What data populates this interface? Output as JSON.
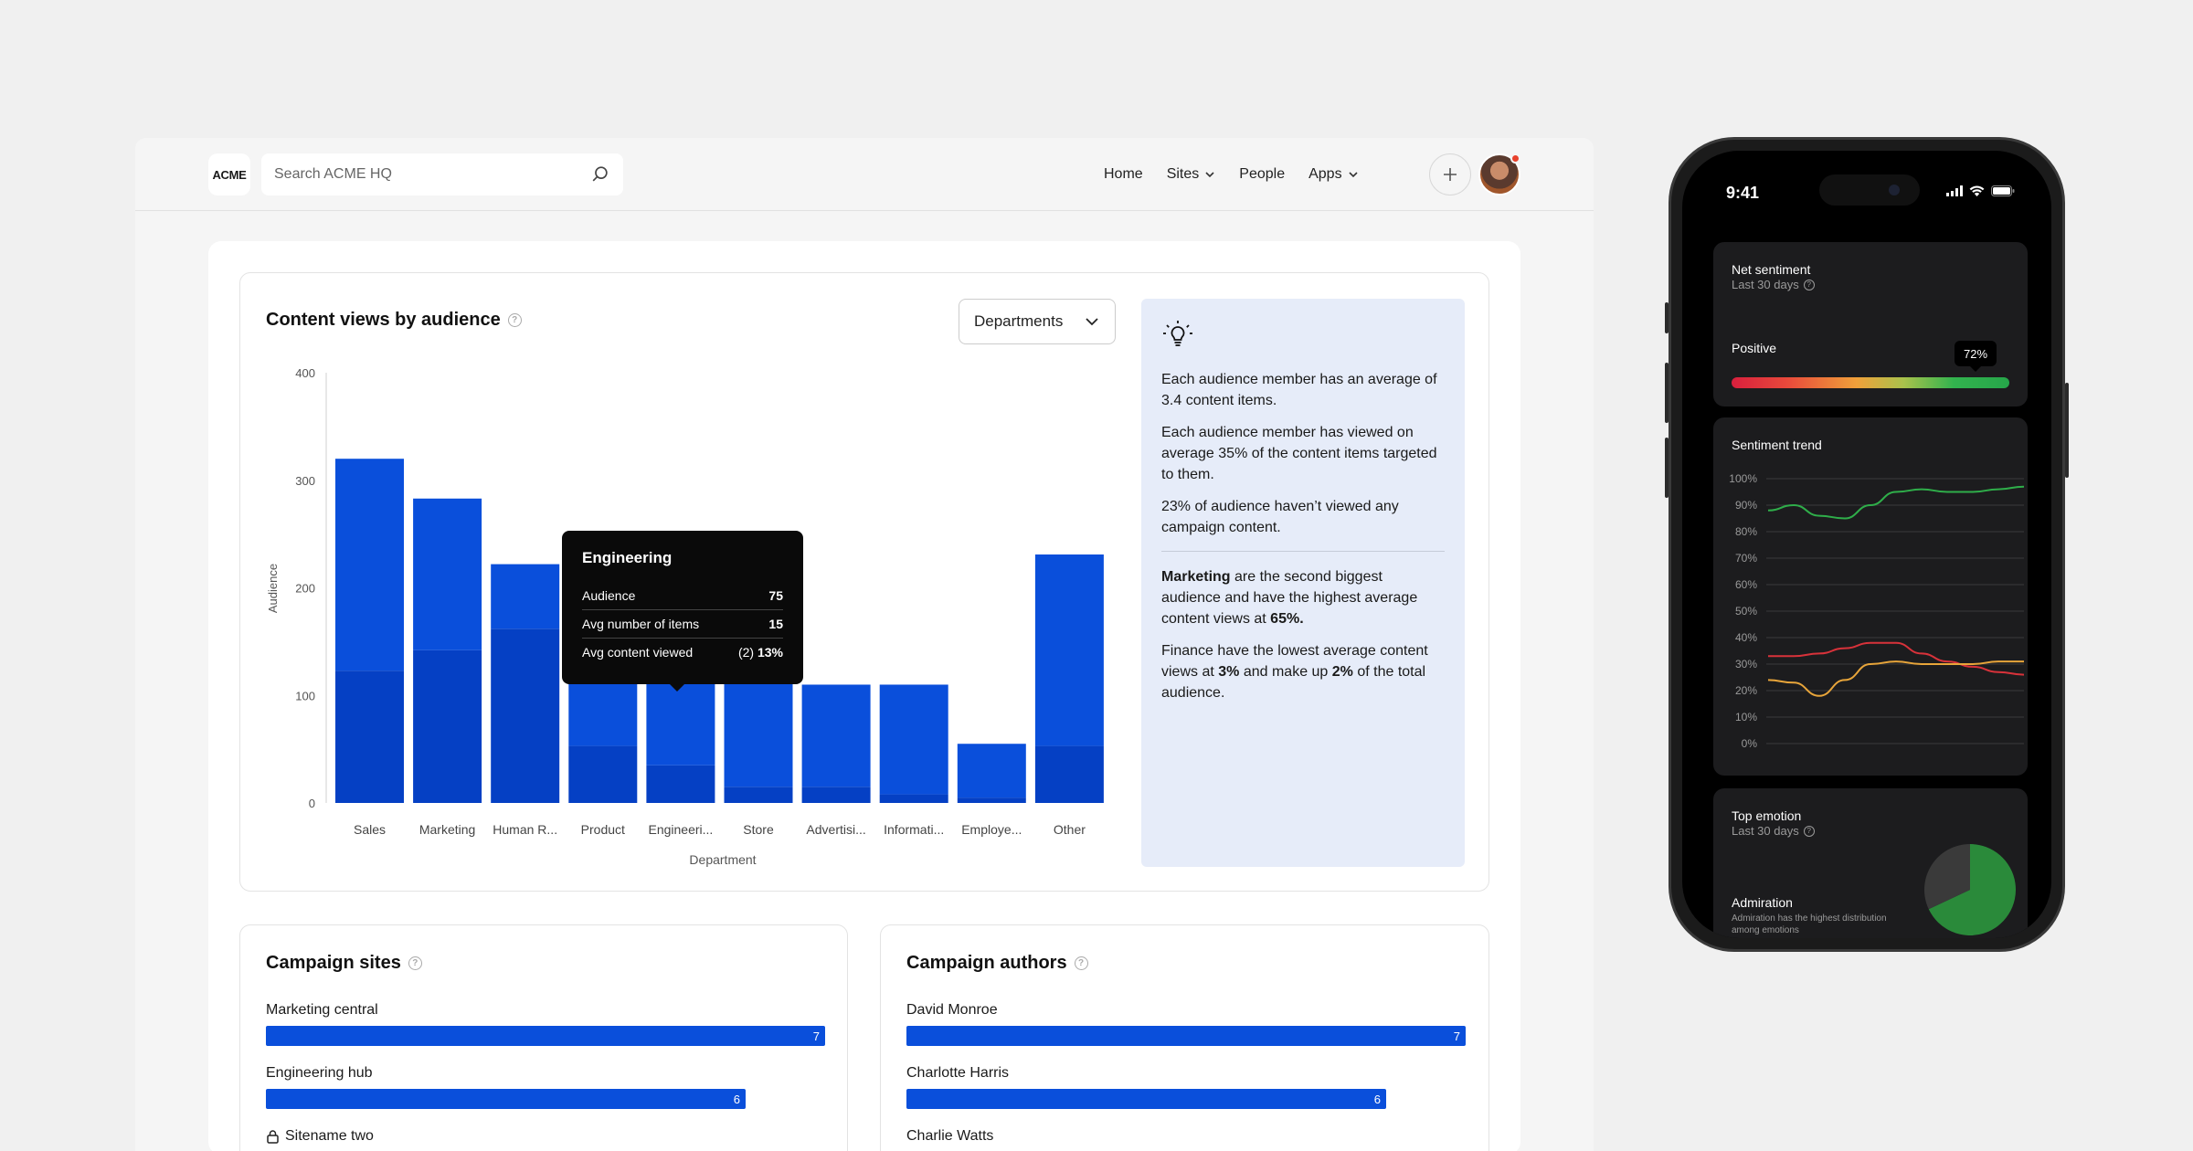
{
  "header": {
    "logo_text": "ACME",
    "search_placeholder": "Search ACME HQ",
    "nav": [
      {
        "label": "Home",
        "has_chevron": false
      },
      {
        "label": "Sites",
        "has_chevron": true
      },
      {
        "label": "People",
        "has_chevron": false
      },
      {
        "label": "Apps",
        "has_chevron": true
      }
    ],
    "notification_color": "#e8412c"
  },
  "audience_card": {
    "title": "Content views by audience",
    "dropdown_value": "Departments",
    "tooltip": {
      "title": "Engineering",
      "rows": [
        {
          "label": "Audience",
          "value": "75"
        },
        {
          "label": "Avg number of items",
          "value": "15"
        },
        {
          "label": "Avg content viewed",
          "value_prefix": "(2) ",
          "value": "13%"
        }
      ]
    },
    "insights": {
      "p1": "Each audience member has an average of 3.4 content items.",
      "p2": "Each audience member has viewed on average 35% of the content items targeted to them.",
      "p3": "23% of audience haven’t viewed any campaign content.",
      "p4_bold": "Marketing",
      "p4_rest": " are the second biggest audience and have the highest average content views at ",
      "p4_bold2": "65%.",
      "p5_a": "Finance have the lowest average content views at ",
      "p5_b": "3%",
      "p5_c": " and make up ",
      "p5_d": "2%",
      "p5_e": " of the total audience."
    }
  },
  "chart_data": {
    "type": "bar",
    "stacked": true,
    "xlabel": "Department",
    "ylabel": "Audience",
    "ylim": [
      0,
      400
    ],
    "yticks": [
      0,
      100,
      200,
      300,
      400
    ],
    "categories": [
      "Sales",
      "Marketing",
      "Human R...",
      "Product",
      "Engineeri...",
      "Store",
      "Advertisi...",
      "Informati...",
      "Employe...",
      "Other"
    ],
    "series": [
      {
        "values": [
          123,
          142,
          162,
          53,
          35,
          15,
          15,
          8,
          5,
          53
        ],
        "color": "#0540c4"
      },
      {
        "values": [
          197,
          141,
          60,
          90,
          78,
          135,
          95,
          102,
          50,
          178
        ],
        "color": "#0a4fdb"
      }
    ],
    "totals": [
      320,
      283,
      222,
      143,
      113,
      150,
      110,
      110,
      55,
      231
    ],
    "grid": false,
    "legend": "none"
  },
  "campaign_sites": {
    "title": "Campaign sites",
    "items": [
      {
        "label": "Marketing central",
        "value": 7,
        "locked": false
      },
      {
        "label": "Engineering hub",
        "value": 6,
        "locked": false
      },
      {
        "label": "Sitename two",
        "value": null,
        "locked": true
      }
    ],
    "max": 7
  },
  "campaign_authors": {
    "title": "Campaign authors",
    "items": [
      {
        "label": "David Monroe",
        "value": 7
      },
      {
        "label": "Charlotte Harris",
        "value": 6
      },
      {
        "label": "Charlie Watts",
        "value": null
      }
    ],
    "max": 7
  },
  "phone": {
    "time": "9:41",
    "net_sentiment": {
      "title": "Net sentiment",
      "subtitle": "Last 30 days",
      "label": "Positive",
      "value": "72%",
      "fraction": 0.88
    },
    "sentiment_trend": {
      "title": "Sentiment trend",
      "yticks": [
        "100%",
        "90%",
        "80%",
        "70%",
        "60%",
        "50%",
        "40%",
        "30%",
        "20%",
        "10%",
        "0%"
      ],
      "series": [
        {
          "color": "#2fae4a",
          "values": [
            88,
            90,
            86,
            85,
            90,
            95,
            96,
            95,
            95,
            96,
            97
          ]
        },
        {
          "color": "#d8323a",
          "values": [
            33,
            33,
            34,
            36,
            38,
            38,
            34,
            31,
            29,
            27,
            26
          ]
        },
        {
          "color": "#e8a53a",
          "values": [
            24,
            23,
            18,
            24,
            30,
            31,
            30,
            30,
            30,
            31,
            31
          ]
        }
      ]
    },
    "top_emotion": {
      "title": "Top emotion",
      "subtitle": "Last 30 days",
      "label": "Admiration",
      "description": "Admiration has the highest distribution among emotions",
      "pie": [
        {
          "value": 0.68,
          "color": "#2a8a3a"
        },
        {
          "value": 0.32,
          "color": "#3a3a3a"
        }
      ]
    }
  }
}
